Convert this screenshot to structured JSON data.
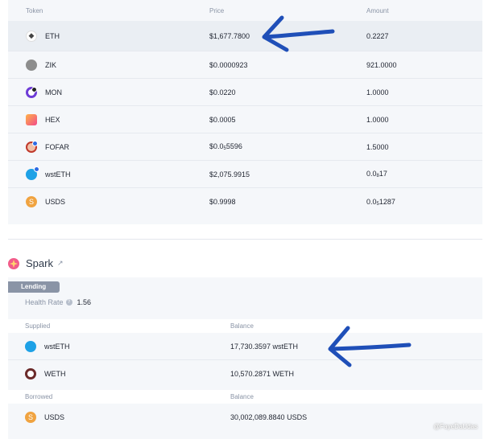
{
  "tokens": {
    "headers": {
      "token": "Token",
      "price": "Price",
      "amount": "Amount"
    },
    "rows": [
      {
        "symbol": "ETH",
        "price": "$1,677.7800",
        "amount": "0.2227",
        "icon": "eth-icon",
        "color": "#627eea"
      },
      {
        "symbol": "ZIK",
        "price": "$0.0000923",
        "amount": "921.0000",
        "icon": "zik-icon",
        "color": "#8d8d8d"
      },
      {
        "symbol": "MON",
        "price": "$0.0220",
        "amount": "1.0000",
        "icon": "mon-icon",
        "color": "#6e3cd6"
      },
      {
        "symbol": "HEX",
        "price": "$0.0005",
        "amount": "1.0000",
        "icon": "hex-icon",
        "color": "#f2498a"
      },
      {
        "symbol": "FOFAR",
        "price_pre": "$0.0",
        "price_sub": "5",
        "price_post": "5596",
        "amount": "1.5000",
        "icon": "fofar-icon",
        "color": "#c0392b"
      },
      {
        "symbol": "wstETH",
        "price": "$2,075.9915",
        "amount_pre": "0.0",
        "amount_sub": "8",
        "amount_post": "17",
        "icon": "wsteth-icon",
        "color": "#1ea1e6"
      },
      {
        "symbol": "USDS",
        "price": "$0.9998",
        "amount_pre": "0.0",
        "amount_sub": "5",
        "amount_post": "1287",
        "icon": "usds-icon",
        "color": "#f0a340"
      }
    ]
  },
  "spark": {
    "title": "Spark",
    "tag": "Lending",
    "health_label": "Health Rate",
    "health_value": "1.56",
    "supplied_header": "Supplied",
    "balance_header": "Balance",
    "supplied": [
      {
        "symbol": "wstETH",
        "balance": "17,730.3597 wstETH",
        "icon": "wsteth-icon"
      },
      {
        "symbol": "WETH",
        "balance": "10,570.2871 WETH",
        "icon": "weth-icon"
      }
    ],
    "borrowed_header": "Borrowed",
    "borrowed": [
      {
        "symbol": "USDS",
        "balance": "30,002,089.8840 USDS",
        "icon": "usds-icon"
      }
    ]
  },
  "watermark": "@FayeDaUdas",
  "colors": {
    "arrow": "#1f4fb8",
    "spark_accent": "#f25c8a"
  }
}
